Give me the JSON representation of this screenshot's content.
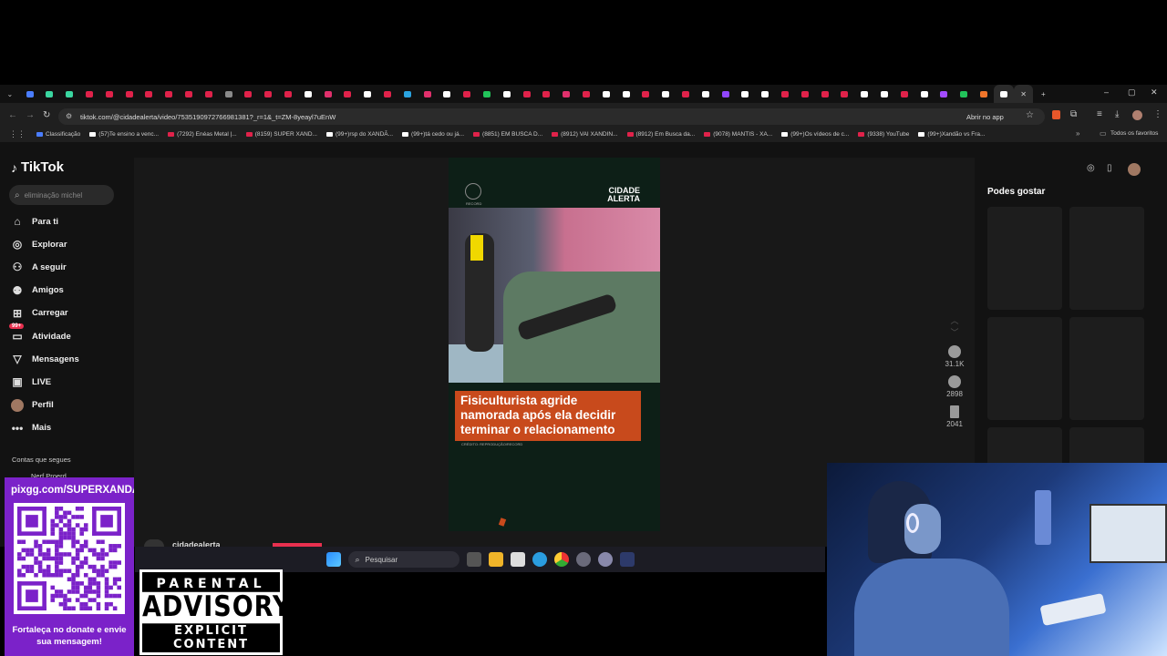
{
  "browser": {
    "url": "tiktok.com/@cidadealerta/video/7535190972766981381?_r=1&_t=ZM-8yeayl7uEnW",
    "open_in_app": "Abrir no app",
    "tab_icon_colors": [
      "#4a7dff",
      "#3ad6a0",
      "#3ad6a0",
      "#e0224a",
      "#e0224a",
      "#e0224a",
      "#e0224a",
      "#e0224a",
      "#e0224a",
      "#e0224a",
      "#8a8a8a",
      "#e0224a",
      "#e0224a",
      "#e0224a",
      "#ffffff",
      "#e1306c",
      "#e0224a",
      "#ffffff",
      "#e0224a",
      "#2aa3e0",
      "#e1306c",
      "#ffffff",
      "#e0224a",
      "#22c35a",
      "#ffffff",
      "#e0224a",
      "#e0224a",
      "#e1306c",
      "#e0224a",
      "#ffffff",
      "#ffffff",
      "#e0224a",
      "#ffffff",
      "#e0224a",
      "#ffffff",
      "#9146ff",
      "#ffffff",
      "#ffffff",
      "#e0224a",
      "#e0224a",
      "#e0224a",
      "#e0224a",
      "#ffffff",
      "#ffffff",
      "#e0224a",
      "#ffffff",
      "#a24bff",
      "#22c35a",
      "#f0752a",
      "#ffffff"
    ],
    "bookmarks": [
      {
        "label": "Classificação",
        "color": "#4a7dff"
      },
      {
        "label": "(57)Te ensino a venc...",
        "color": "#ffffff"
      },
      {
        "label": "(7292) Enéas Metal |...",
        "color": "#e0224a"
      },
      {
        "label": "(8159) SUPER XAND...",
        "color": "#e0224a"
      },
      {
        "label": "(99+)rsp do XANDÃ...",
        "color": "#ffffff"
      },
      {
        "label": "(99+)tá cedo ou já...",
        "color": "#ffffff"
      },
      {
        "label": "(8851) EM BUSCA D...",
        "color": "#e0224a"
      },
      {
        "label": "(8912) VAI XANDIN...",
        "color": "#e0224a"
      },
      {
        "label": "(8912) Em Busca da...",
        "color": "#e0224a"
      },
      {
        "label": "(9078) MANTIS - XA...",
        "color": "#e0224a"
      },
      {
        "label": "(99+)Os vídeos de c...",
        "color": "#ffffff"
      },
      {
        "label": "(9338) YouTube",
        "color": "#e0224a"
      },
      {
        "label": "(99+)Xandão vs Fra...",
        "color": "#ffffff"
      }
    ],
    "all_bookmarks": "Todos os favoritos"
  },
  "tiktok": {
    "logo": "TikTok",
    "search_placeholder": "eliminação michel",
    "nav": [
      {
        "label": "Para ti",
        "icon": "home-icon"
      },
      {
        "label": "Explorar",
        "icon": "compass-icon"
      },
      {
        "label": "A seguir",
        "icon": "following-icon"
      },
      {
        "label": "Amigos",
        "icon": "friends-icon"
      },
      {
        "label": "Carregar",
        "icon": "upload-icon"
      },
      {
        "label": "Atividade",
        "icon": "inbox-icon",
        "badge": "99+"
      },
      {
        "label": "Mensagens",
        "icon": "send-icon"
      },
      {
        "label": "LIVE",
        "icon": "live-icon"
      },
      {
        "label": "Perfil",
        "icon": "avatar-icon"
      },
      {
        "label": "Mais",
        "icon": "more-icon"
      }
    ],
    "following_title": "Contas que segues",
    "following_first": "Nerf Proerd",
    "video": {
      "brand": "CIDADE ALERTA",
      "network": "RECORD",
      "headline": "Fisiculturista agride namorada após ela decidir terminar o relacionamento",
      "credit": "CRÉDITO: REPRODUÇÃO/RECORD"
    },
    "author": "cidadealerta",
    "likes": "31.1K",
    "comments": "2898",
    "saves": "2041",
    "recommend_title": "Podes gostar"
  },
  "taskbar": {
    "search": "Pesquisar"
  },
  "overlay": {
    "qr_url": "pixgg.com/SUPERXANDAO",
    "qr_message": "Fortaleça no donate e envie sua mensagem!",
    "advisory_top": "PARENTAL",
    "advisory_mid": "ADVISORY",
    "advisory_bottom": "EXPLICIT CONTENT"
  }
}
